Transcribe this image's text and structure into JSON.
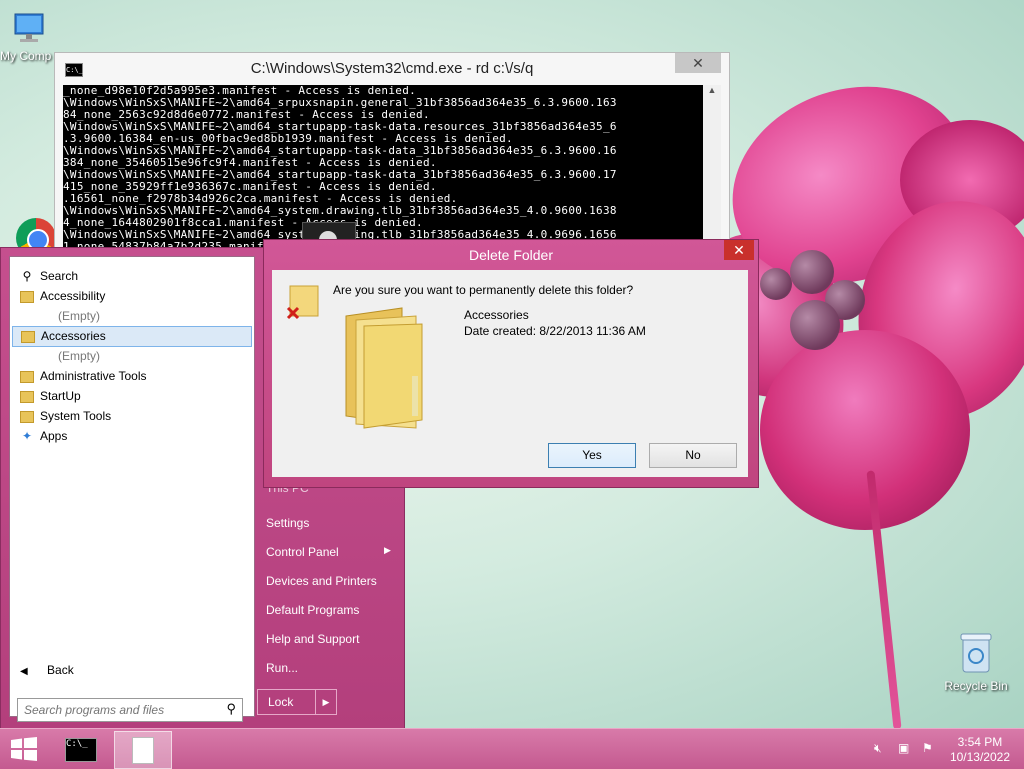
{
  "desktop": {
    "icons": {
      "my_computer": "My Comp",
      "recycle_bin": "Recycle Bin"
    }
  },
  "cmd": {
    "title": "C:\\Windows\\System32\\cmd.exe - rd  c:\\/s/q",
    "lines": [
      "_none_d98e10f2d5a995e3.manifest - Access is denied.",
      "\\Windows\\WinSxS\\MANIFE~2\\amd64_srpuxsnapin.general_31bf3856ad364e35_6.3.9600.163",
      "84_none_2563c92d8d6e0772.manifest - Access is denied.",
      "\\Windows\\WinSxS\\MANIFE~2\\amd64_startupapp-task-data.resources_31bf3856ad364e35_6",
      ".3.9600.16384_en-us_00fbac9ed8bb1939.manifest - Access is denied.",
      "\\Windows\\WinSxS\\MANIFE~2\\amd64_startupapp-task-data_31bf3856ad364e35_6.3.9600.16",
      "384_none_35460515e96fc9f4.manifest - Access is denied.",
      "\\Windows\\WinSxS\\MANIFE~2\\amd64_startupapp-task-data_31bf3856ad364e35_6.3.9600.17",
      "415_none_35929ff1e936367c.manifest - Access is denied.",
      ".16561_none_f2978b34d926c2ca.manifest - Access is denied.",
      "\\Windows\\WinSxS\\MANIFE~2\\amd64_system.drawing.tlb_31bf3856ad364e35_4.0.9600.1638",
      "4_none_1644802901f8cca1.manifest - Access is denied.",
      "\\Windows\\WinSxS\\MANIFE~2\\amd64_system.drawing.tlb_31bf3856ad364e35_4.0.9696.1656",
      "1_none_54837b84a7b2d235.manifest - Access is denied."
    ]
  },
  "start_menu": {
    "items": [
      {
        "label": "Search"
      },
      {
        "label": "Accessibility"
      },
      {
        "label": "(Empty)"
      },
      {
        "label": "Accessories"
      },
      {
        "label": "(Empty)"
      },
      {
        "label": "Administrative Tools"
      },
      {
        "label": "StartUp"
      },
      {
        "label": "System Tools"
      },
      {
        "label": "Apps"
      }
    ],
    "back_label": "Back",
    "search_placeholder": "Search programs and files",
    "right_items": {
      "this_pc": "This PC",
      "settings": "Settings",
      "control_panel": "Control Panel",
      "devices_printers": "Devices and Printers",
      "default_programs": "Default Programs",
      "help_support": "Help and Support",
      "run": "Run..."
    },
    "lock_label": "Lock"
  },
  "dialog": {
    "title": "Delete Folder",
    "question": "Are you sure you want to permanently delete this folder?",
    "folder_name": "Accessories",
    "date_created": "Date created: 8/22/2013 11:36 AM",
    "yes_label": "Yes",
    "no_label": "No",
    "close_label": "✕"
  },
  "taskbar": {
    "time": "3:54 PM",
    "date": "10/13/2022"
  }
}
